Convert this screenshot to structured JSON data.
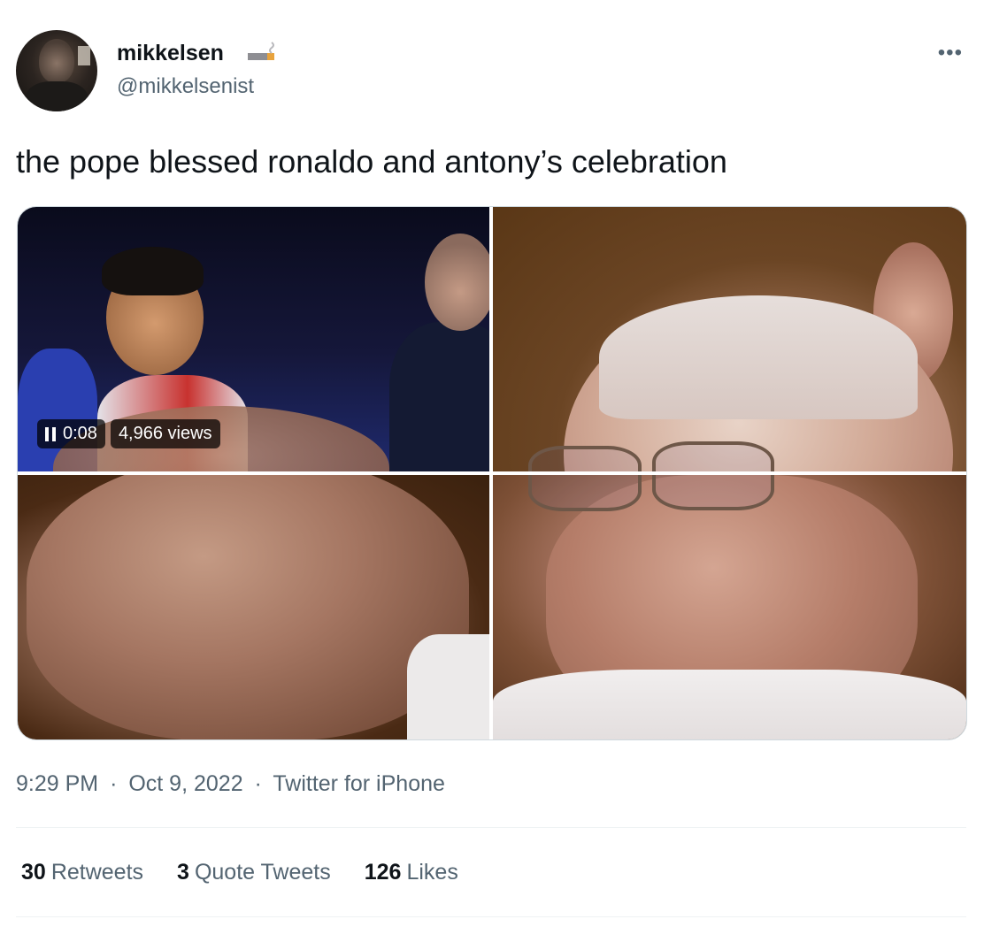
{
  "author": {
    "display_name": "mikkelsen",
    "name_emoji": "cigarette-icon",
    "handle": "@mikkelsenist"
  },
  "menu": {
    "more_icon": "more-horizontal-icon",
    "more_glyph": "•••"
  },
  "tweet": {
    "text": "the pope blessed ronaldo and antony’s celebration"
  },
  "video": {
    "pause_icon": "pause-icon",
    "elapsed": "0:08",
    "views": "4,966 views"
  },
  "meta": {
    "time": "9:29 PM",
    "date": "Oct 9, 2022",
    "source": "Twitter for iPhone",
    "separator": "·"
  },
  "stats": [
    {
      "count": "30",
      "label": "Retweets"
    },
    {
      "count": "3",
      "label": "Quote Tweets"
    },
    {
      "count": "126",
      "label": "Likes"
    }
  ],
  "colors": {
    "text_primary": "#0f1419",
    "text_secondary": "#536471",
    "divider": "#eff3f4",
    "media_border": "#cfd9de"
  }
}
